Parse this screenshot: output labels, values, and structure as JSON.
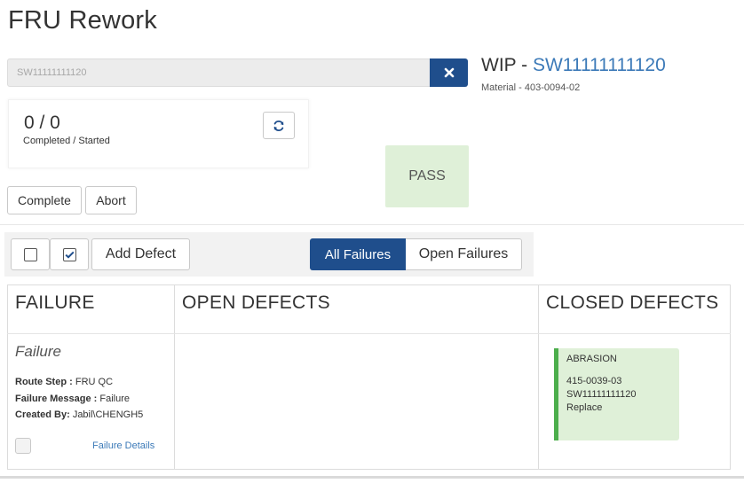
{
  "page": {
    "title": "FRU Rework"
  },
  "search": {
    "value": "SW11111111120"
  },
  "wip": {
    "prefix": "WIP - ",
    "serial": "SW11111111120",
    "material": "Material - 403-0094-02"
  },
  "counter": {
    "value": "0 / 0",
    "label": "Completed / Started"
  },
  "status": {
    "label": "PASS",
    "color": "#dff0d8"
  },
  "actions": {
    "complete": "Complete",
    "abort": "Abort"
  },
  "toolbar": {
    "add_defect": "Add Defect",
    "tabs": [
      {
        "label": "All Failures",
        "active": true
      },
      {
        "label": "Open Failures",
        "active": false
      }
    ]
  },
  "columns": {
    "failure": "FAILURE",
    "open_defects": "OPEN DEFECTS",
    "closed_defects": "CLOSED DEFECTS"
  },
  "failure": {
    "name": "Failure",
    "route_step_label": "Route Step :",
    "route_step": "FRU QC",
    "failure_message_label": "Failure Message :",
    "failure_message": "Failure",
    "created_by_label": "Created By:",
    "created_by": "Jabil\\CHENGH5",
    "details_link": "Failure Details"
  },
  "closed_defects": [
    {
      "type": "ABRASION",
      "part": "415-0039-03",
      "serial": "SW11111111120",
      "action": "Replace"
    }
  ],
  "colors": {
    "primary": "#1f4e8c",
    "link": "#3c7ab8",
    "pass_bg": "#dff0d8",
    "defect_accent": "#4cae4c"
  },
  "icons": {
    "clear": "close-icon",
    "refresh": "refresh-icon",
    "check": "checkbox-checked-icon"
  }
}
